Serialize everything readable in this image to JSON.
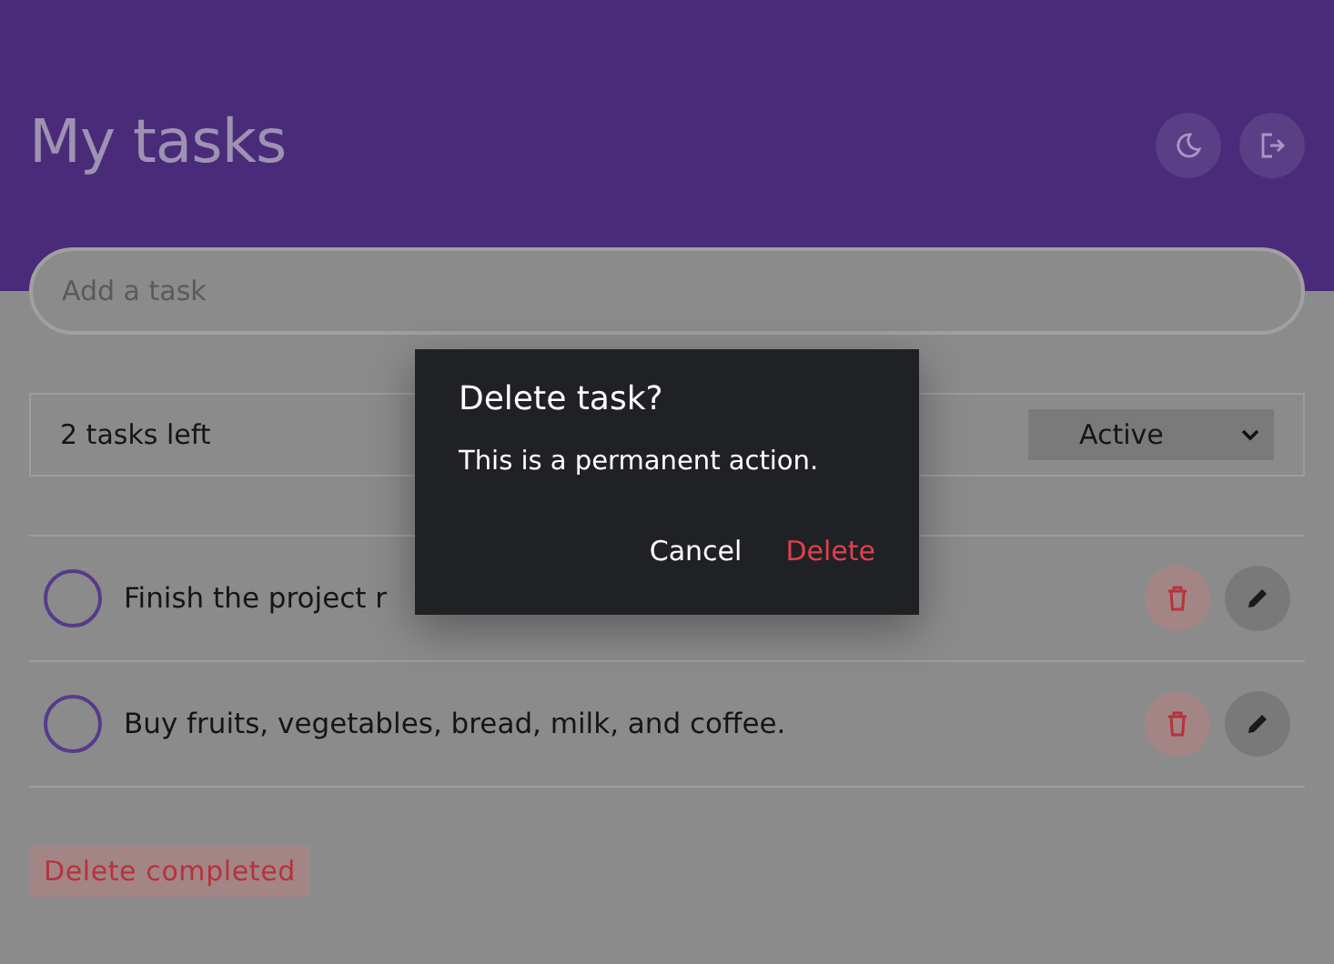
{
  "header": {
    "title": "My tasks"
  },
  "new_task": {
    "placeholder": "Add a task"
  },
  "summary": {
    "count": "2 tasks left",
    "filter": "Active"
  },
  "tasks": [
    {
      "text": "Finish the project r",
      "completed": false
    },
    {
      "text": "Buy fruits, vegetables, bread, milk, and coffee.",
      "completed": false
    }
  ],
  "clear_button": "Delete completed",
  "dialog": {
    "title": "Delete task?",
    "message": "This is a permanent action.",
    "buttons": [
      {
        "label": "Cancel",
        "kind": "neutral"
      },
      {
        "label": "Delete",
        "kind": "danger"
      }
    ]
  }
}
